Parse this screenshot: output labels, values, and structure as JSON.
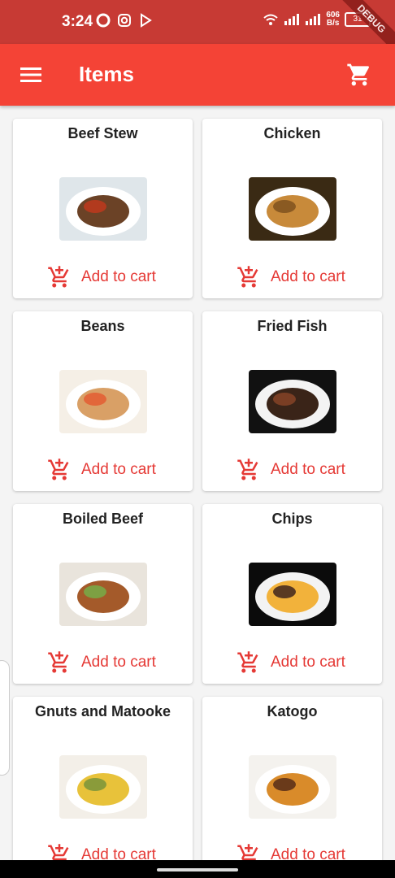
{
  "status_bar": {
    "time": "3:24",
    "net_speed_value": "606",
    "net_speed_unit": "B/s",
    "battery": "31"
  },
  "debug_banner": "DEBUG",
  "app_bar": {
    "title": "Items"
  },
  "items": [
    {
      "name": "Beef Stew",
      "add_label": "Add to cart",
      "colors": [
        "#6b4226",
        "#b23a1e",
        "#dfe6ea"
      ]
    },
    {
      "name": "Chicken",
      "add_label": "Add to cart",
      "colors": [
        "#c88a3a",
        "#8a5a22",
        "#3a2a14"
      ]
    },
    {
      "name": "Beans",
      "add_label": "Add to cart",
      "colors": [
        "#d9a066",
        "#e2673a",
        "#f5efe6"
      ]
    },
    {
      "name": "Fried Fish",
      "add_label": "Add to cart",
      "colors": [
        "#3a2418",
        "#7a3e24",
        "#111111"
      ]
    },
    {
      "name": "Boiled Beef",
      "add_label": "Add to cart",
      "colors": [
        "#a45a2a",
        "#7da043",
        "#e9e4dc"
      ]
    },
    {
      "name": "Chips",
      "add_label": "Add to cart",
      "colors": [
        "#f2b23b",
        "#5a3a22",
        "#0b0b0b"
      ]
    },
    {
      "name": "Gnuts and Matooke",
      "add_label": "Add to cart",
      "colors": [
        "#e8c23a",
        "#8a9b3a",
        "#f3efe8"
      ]
    },
    {
      "name": "Katogo",
      "add_label": "Add to cart",
      "colors": [
        "#d98b2a",
        "#6a3a1a",
        "#f4f2ee"
      ]
    }
  ],
  "accent_color": "#f44336"
}
